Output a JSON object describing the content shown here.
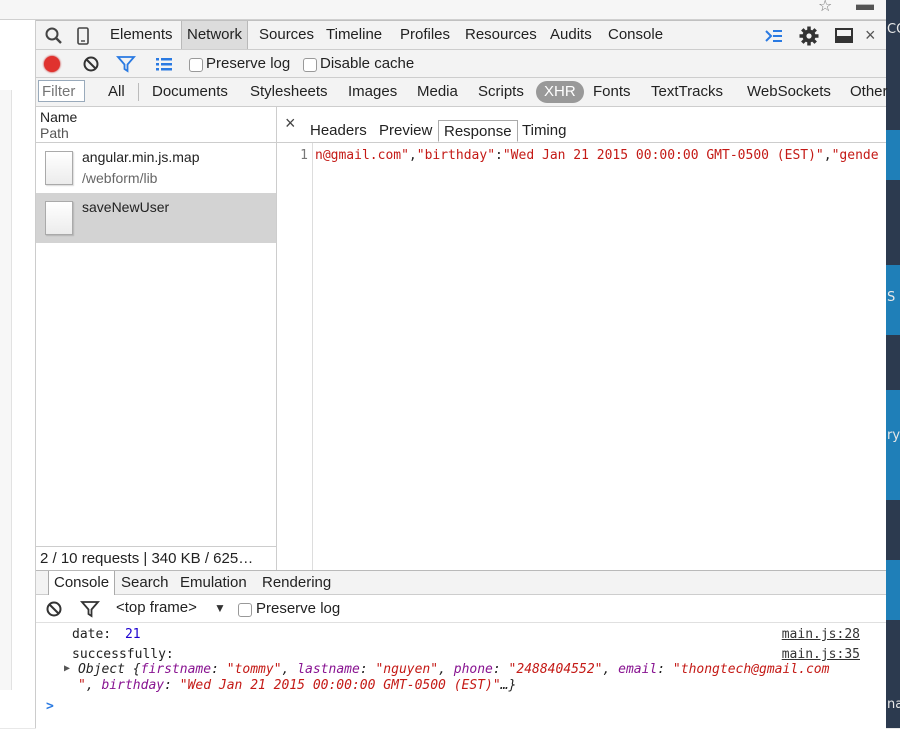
{
  "devtools": {
    "panels": [
      "Elements",
      "Network",
      "Sources",
      "Timeline",
      "Profiles",
      "Resources",
      "Audits",
      "Console"
    ],
    "selected_panel": "Network"
  },
  "network_toolbar": {
    "preserve_log": "Preserve log",
    "disable_cache": "Disable cache"
  },
  "filter": {
    "placeholder": "Filter",
    "types": [
      "All",
      "Documents",
      "Stylesheets",
      "Images",
      "Media",
      "Scripts",
      "XHR",
      "Fonts",
      "TextTracks",
      "WebSockets",
      "Other"
    ],
    "selected": "XHR"
  },
  "request_list": {
    "col_name": "Name",
    "col_path": "Path",
    "rows": [
      {
        "name": "angular.min.js.map",
        "path": "/webform/lib"
      },
      {
        "name": "saveNewUser",
        "path": ""
      }
    ],
    "status": "2 / 10 requests | 340 KB / 625…"
  },
  "detail": {
    "close": "×",
    "tabs": [
      "Headers",
      "Preview",
      "Response",
      "Timing"
    ],
    "selected_tab": "Response",
    "line_number": "1",
    "code": {
      "a": "n@gmail.com\"",
      "b": ",",
      "c": "\"birthday\"",
      "d": ":",
      "e": "\"Wed Jan 21 2015 00:00:00 GMT-0500 (EST)\"",
      "f": ",",
      "g": "\"gende"
    }
  },
  "drawer": {
    "tabs": [
      "Console",
      "Search",
      "Emulation",
      "Rendering"
    ],
    "selected_tab": "Console",
    "frame": "<top frame>",
    "preserve_log": "Preserve log"
  },
  "console": {
    "line1": {
      "label": "date:",
      "value": "21",
      "source": "main.js:28"
    },
    "line2": {
      "label": "successfully:",
      "source": "main.js:35"
    },
    "object": {
      "prefix": "Object {",
      "k1": "firstname",
      "v1": "\"tommy\"",
      "k2": "lastname",
      "v2": "\"nguyen\"",
      "k3": "phone",
      "v3": "\"2488404552\"",
      "k4": "email",
      "v4": "\"thongtech@gmail.com",
      "v4b": "\"",
      "k5": "birthday",
      "v5": "\"Wed Jan 21 2015 00:00:00 GMT-0500 (EST)\"",
      "suffix": "…}"
    },
    "prompt": ">"
  },
  "right_strip": {
    "t1": "CO",
    "t2": "S",
    "t3": "ry",
    "t4": "na"
  },
  "colors": {
    "record": "#e0322e",
    "accent": "#2a7ae2",
    "selected_filter": "#999999"
  }
}
